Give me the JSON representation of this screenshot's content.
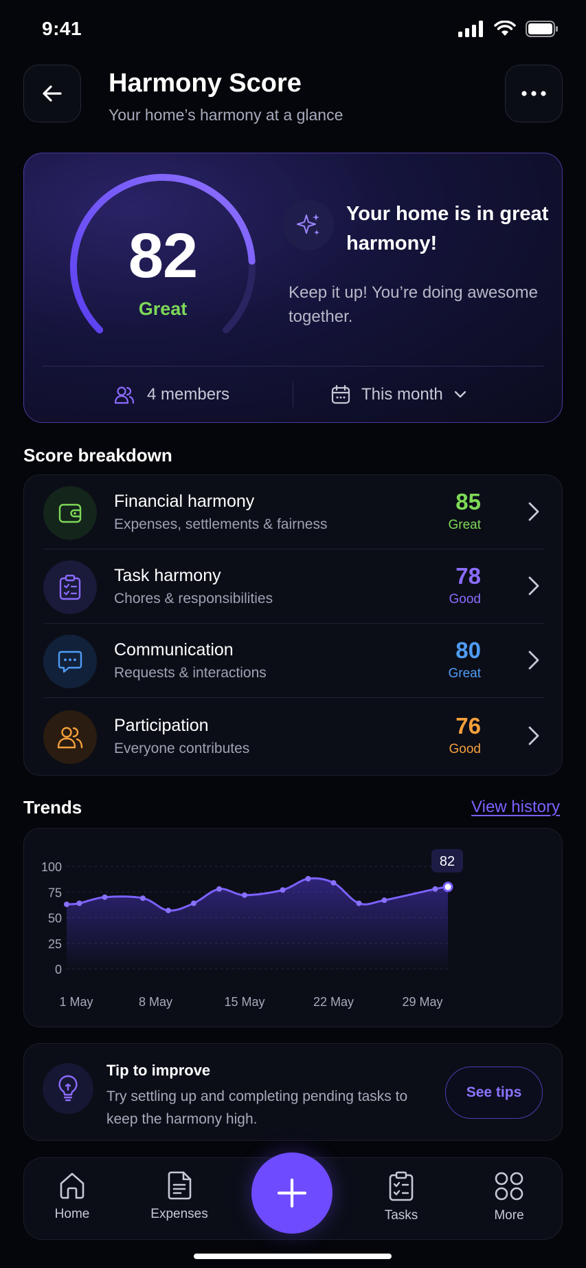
{
  "status_bar": {
    "time": "9:41"
  },
  "header": {
    "title": "Harmony Score",
    "subtitle": "Your home’s harmony at a glance"
  },
  "hero": {
    "score": "82",
    "score_fraction": 0.82,
    "score_label": "Great",
    "headline": "Your home is in great harmony!",
    "message": "Keep it up! You’re doing awesome together.",
    "members": "4 members",
    "period": "This month"
  },
  "breakdown": {
    "title": "Score breakdown",
    "items": [
      {
        "title": "Financial harmony",
        "subtitle": "Expenses, settlements & fairness",
        "score": "85",
        "rating": "Great",
        "color": "#7ed957",
        "icon": "wallet-icon",
        "icon_bg": "#14251b"
      },
      {
        "title": "Task harmony",
        "subtitle": "Chores & responsibilities",
        "score": "78",
        "rating": "Good",
        "color": "#8b6cff",
        "icon": "clipboard-icon",
        "icon_bg": "#1a1a3a"
      },
      {
        "title": "Communication",
        "subtitle": "Requests & interactions",
        "score": "80",
        "rating": "Great",
        "color": "#4f9cf5",
        "icon": "chat-icon",
        "icon_bg": "#12213a"
      },
      {
        "title": "Participation",
        "subtitle": "Everyone contributes",
        "score": "76",
        "rating": "Good",
        "color": "#f5a03c",
        "icon": "people-icon",
        "icon_bg": "#2a1c10"
      }
    ]
  },
  "trends": {
    "title": "Trends",
    "view_history": "View history",
    "current_label": "82"
  },
  "chart_data": {
    "type": "area",
    "x_ticks": [
      "1 May",
      "8 May",
      "15 May",
      "22 May",
      "29 May"
    ],
    "y_ticks": [
      "100",
      "75",
      "50",
      "25",
      "0"
    ],
    "ylim": [
      0,
      100
    ],
    "xlim": [
      1,
      31
    ],
    "x": [
      1,
      2,
      4,
      7,
      9,
      11,
      13,
      15,
      18,
      20,
      22,
      24,
      26,
      30,
      31
    ],
    "y": [
      63,
      64,
      70,
      69,
      57,
      64,
      78,
      72,
      77,
      88,
      84,
      64,
      67,
      78,
      80
    ]
  },
  "tip": {
    "title": "Tip to improve",
    "body": "Try settling up and completing pending tasks to keep the harmony high.",
    "button": "See tips"
  },
  "nav": {
    "items": [
      {
        "label": "Home",
        "icon": "home-icon"
      },
      {
        "label": "Expenses",
        "icon": "document-icon"
      },
      {
        "label": "Tasks",
        "icon": "tasks-icon"
      },
      {
        "label": "More",
        "icon": "grid-icon"
      }
    ],
    "fab_icon": "plus-icon"
  },
  "colors": {
    "accent": "#6f4bff",
    "background": "#05060b",
    "great": "#7ed957"
  }
}
